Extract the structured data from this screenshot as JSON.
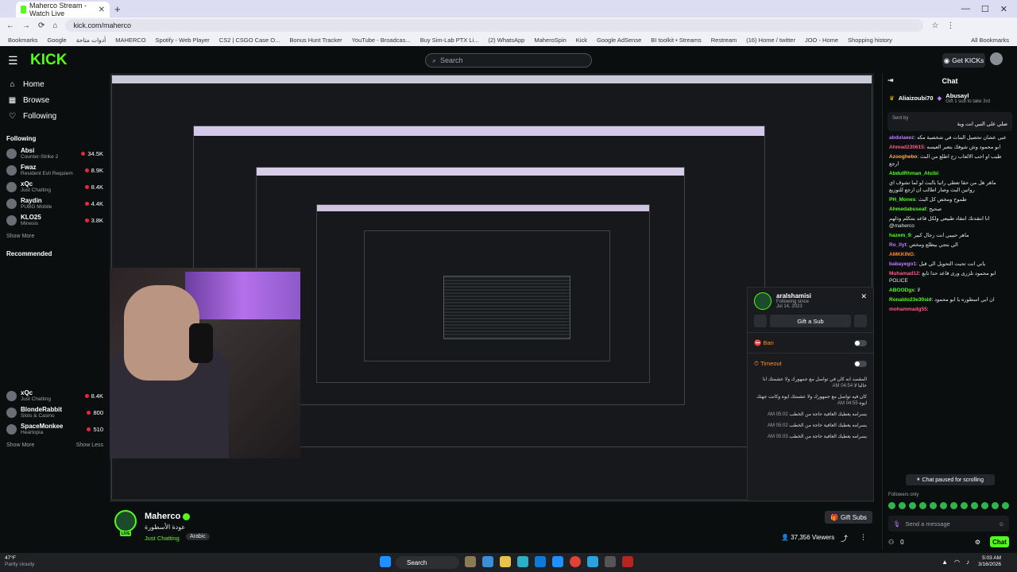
{
  "browser": {
    "tab_title": "Maherco Stream - Watch Live",
    "url": "kick.com/maherco",
    "bookmarks": [
      "Bookmarks",
      "Google",
      "أدوات متاحة",
      "MAHERCO",
      "Spotify - Web Player",
      "CS2 | CSGO Case O...",
      "Bonus Hunt Tracker",
      "YouTube - Broadcas...",
      "Buy Sim-Lab PTX Li...",
      "(2) WhatsApp",
      "MaheroSpin",
      "Kick",
      "Google AdSense",
      "BI toolkit • Streams",
      "Restream",
      "(16) Home / twitter",
      "JOO - Home",
      "Shopping history"
    ],
    "all_bookmarks": "All Bookmarks"
  },
  "header": {
    "logo": "KICK",
    "search_placeholder": "Search",
    "get_kicks": "Get KICKs"
  },
  "sidebar": {
    "nav": [
      {
        "label": "Home",
        "icon": "home-icon"
      },
      {
        "label": "Browse",
        "icon": "browse-icon"
      },
      {
        "label": "Following",
        "icon": "heart-icon"
      }
    ],
    "following_title": "Following",
    "following": [
      {
        "name": "Absi",
        "game": "Counter-Strike 2",
        "viewers": "34.5K"
      },
      {
        "name": "Fwaz",
        "game": "Resident Evil Requiem",
        "viewers": "8.9K"
      },
      {
        "name": "xQc",
        "game": "Just Chatting",
        "viewers": "8.4K"
      },
      {
        "name": "Raydin",
        "game": "PUBG Mobile",
        "viewers": "4.4K"
      },
      {
        "name": "KLO25",
        "game": "Minesis",
        "viewers": "3.8K"
      }
    ],
    "show_more": "Show More",
    "recommended_title": "Recommended",
    "recommended": [
      {
        "name": "xQc",
        "game": "Just Chatting",
        "viewers": "8.4K"
      },
      {
        "name": "BlondeRabbit",
        "game": "Slots & Casino",
        "viewers": "800"
      },
      {
        "name": "SpaceMonkee",
        "game": "Heartopia",
        "viewers": "510"
      }
    ],
    "show_more_2": "Show More",
    "show_less": "Show Less"
  },
  "mod_card": {
    "username": "aralshamisi",
    "following_since_label": "Following since",
    "following_since": "Jul 14, 2023",
    "gift_sub": "Gift a Sub",
    "ban": "Ban",
    "timeout": "Timeout",
    "messages": [
      {
        "time": "04:54 AM",
        "text": "المقصد انه كان في تواصل مع جمهورك ولا عشمتك انا حاليا لا"
      },
      {
        "time": "04:55 AM",
        "text": "كان فيه تواصل مع جمهورك ولا عشمتك ايوه وكانت جهتك ايوه"
      },
      {
        "time": "05:02 AM",
        "text": "يسرامه يعطيك العافية حاجة من الخطب"
      },
      {
        "time": "05:02 AM",
        "text": "يسرامه يعطيك العافية حاجة من الخطب"
      },
      {
        "time": "05:03 AM",
        "text": "يسرامه يعطيك العافية حاجة من الخطب"
      }
    ]
  },
  "stream": {
    "streamer": "Maherco",
    "title": "عودة الأسطورة",
    "category": "Just Chatting",
    "tag": "Arabic",
    "gift_subs": "Gift Subs",
    "viewers": "37,356 Viewers"
  },
  "chat": {
    "title": "Chat",
    "gifters": [
      {
        "name": "Aliaizoubi70",
        "sub": ""
      },
      {
        "name": "Abusayl",
        "sub": "Gift 1 sub to take 3rd"
      }
    ],
    "pinned_sent_by": "Sent by",
    "pinned_text": "صلي على النبي انت وية",
    "messages": [
      {
        "user": "abdulaeez",
        "color": "#c27cff",
        "text": "عبي عشان تحصيل البنات في شخصية مكه"
      },
      {
        "user": "Ahmad230615",
        "color": "#ff5a8a",
        "text": "ابو محمود وش شوفك بتعبر العيسه"
      },
      {
        "user": "Azooghebo",
        "color": "#ffb347",
        "text": "طيب او احب الالعاب زج اطلع من البث ارجع"
      },
      {
        "user": "AbdulRhman_Alsibi",
        "color": "#53fc18",
        "text": ""
      },
      {
        "user": "",
        "color": "#e6e8ea",
        "text": "ماهر هل من حقا تعطي راتيا بالبث لو لما تشوف اي رواتين البث وصار اطالب ان ارجع للتوزيع"
      },
      {
        "user": "PH_Mones",
        "color": "#53fc18",
        "text": "طموح ومخص كل البث"
      },
      {
        "user": "Ahmedabuseaf",
        "color": "#53fc18",
        "text": "صحيح"
      },
      {
        "user": "",
        "color": "#e6e8ea",
        "text": "انا انتقدتك انتقاد طبيعي ولكل قاعد بتتكلم وذلهم @maherco"
      },
      {
        "user": "hazem_9",
        "color": "#53fc18",
        "text": "ماهر حبيبي انت رجال كبير"
      },
      {
        "user": "Ro_llyt",
        "color": "#c27cff",
        "text": "الي بتجي بيطلع ومخص"
      },
      {
        "user": "AMKKING",
        "color": "#ff8c2b",
        "text": ""
      },
      {
        "user": "babayego1",
        "color": "#c27cff",
        "text": "ياني انت تحبت التحويل الي قبل"
      },
      {
        "user": "Muhamad12",
        "color": "#ff5a8a",
        "text": "ابو محمود تلزرى ورى قاعد حدا تابع POLICE"
      },
      {
        "user": "ABOODgx",
        "color": "#53fc18",
        "text": "لا"
      },
      {
        "user": "Ronaldo23e30sid",
        "color": "#53fc18",
        "text": "ان ابي اسطوره يا ابو محمود"
      },
      {
        "user": "mohammadg55",
        "color": "#ff5a8a",
        "text": ""
      }
    ],
    "paused_label": "Chat paused for scrolling",
    "followers_only": "Followers only",
    "send_placeholder": "Send a message",
    "footer_count": "0",
    "chat_button": "Chat"
  },
  "taskbar": {
    "temp": "47°F",
    "weather": "Partly cloudy",
    "search": "Search",
    "time": "5:03 AM",
    "date": "3/16/2026"
  }
}
